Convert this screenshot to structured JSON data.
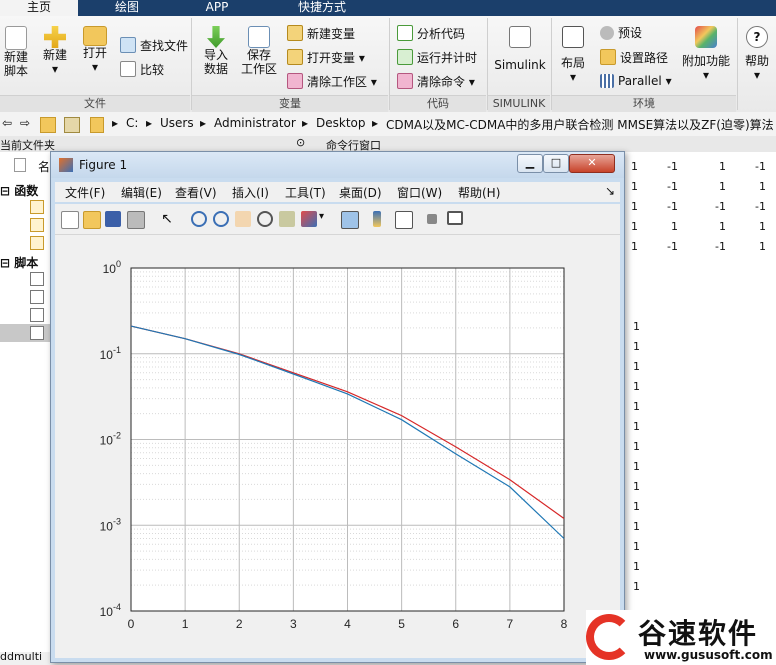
{
  "tabs": [
    "主页",
    "绘图",
    "APP",
    "快捷方式"
  ],
  "ribbon": {
    "file": {
      "label": "文件",
      "new_script": "新建\n脚本",
      "new": "新建",
      "open": "打开",
      "find_files": "查找文件",
      "compare": "比较"
    },
    "variable": {
      "label": "变量",
      "import": "导入\n数据",
      "save_ws": "保存\n工作区",
      "new_var": "新建变量",
      "open_var": "打开变量",
      "clear_ws": "清除工作区"
    },
    "code": {
      "label": "代码",
      "analyze": "分析代码",
      "run_time": "运行并计时",
      "clear_cmd": "清除命令"
    },
    "simulink": {
      "label": "SIMULINK",
      "btn": "Simulink"
    },
    "env": {
      "label": "环境",
      "layout": "布局",
      "prefs": "预设",
      "set_path": "设置路径",
      "parallel": "Parallel",
      "addons": "附加功能"
    },
    "resources": {
      "help": "帮助"
    }
  },
  "address": {
    "crumbs": [
      "C:",
      "Users",
      "Administrator",
      "Desktop",
      "CDMA以及MC-CDMA中的多用户联合检测 MMSE算法以及ZF(迫零)算法"
    ]
  },
  "panes": {
    "current_folder": "当前文件夹",
    "command_window": "命令行窗口",
    "name_col": "名"
  },
  "tree": {
    "functions": "函数",
    "scripts": "脚本",
    "bottom_file": "ddmulti"
  },
  "cmd_matrix": [
    [
      "1",
      "-1",
      "1",
      "-1"
    ],
    [
      "1",
      "-1",
      "1",
      "1"
    ],
    [
      "1",
      "-1",
      "-1",
      "-1"
    ],
    [
      "1",
      "1",
      "1",
      "1"
    ],
    [
      "1",
      "-1",
      "-1",
      "1"
    ]
  ],
  "cmd_ones_count_label": "1",
  "figure": {
    "title": "Figure 1",
    "menu": [
      "文件(F)",
      "编辑(E)",
      "查看(V)",
      "插入(I)",
      "工具(T)",
      "桌面(D)",
      "窗口(W)",
      "帮助(H)"
    ]
  },
  "chart_data": {
    "type": "line",
    "title": "",
    "xlabel": "",
    "ylabel": "",
    "xlim": [
      0,
      8
    ],
    "ylim": [
      0.0001,
      1
    ],
    "yscale": "log",
    "grid": true,
    "x": [
      0,
      1,
      2,
      3,
      4,
      5,
      6,
      7,
      8
    ],
    "xticks": [
      "0",
      "1",
      "2",
      "3",
      "4",
      "5",
      "6",
      "7",
      "8"
    ],
    "yticks": [
      "10^-4",
      "10^-3",
      "10^-2",
      "10^-1",
      "10^0"
    ],
    "series": [
      {
        "color": "#d62728",
        "values": [
          0.21,
          0.15,
          0.1,
          0.06,
          0.036,
          0.019,
          0.0082,
          0.0034,
          0.0012
        ]
      },
      {
        "color": "#1f77b4",
        "values": [
          0.21,
          0.15,
          0.098,
          0.058,
          0.034,
          0.017,
          0.0068,
          0.0028,
          0.0007
        ]
      }
    ]
  },
  "watermark": {
    "name": "谷速软件",
    "url": "www.gususoft.com"
  }
}
